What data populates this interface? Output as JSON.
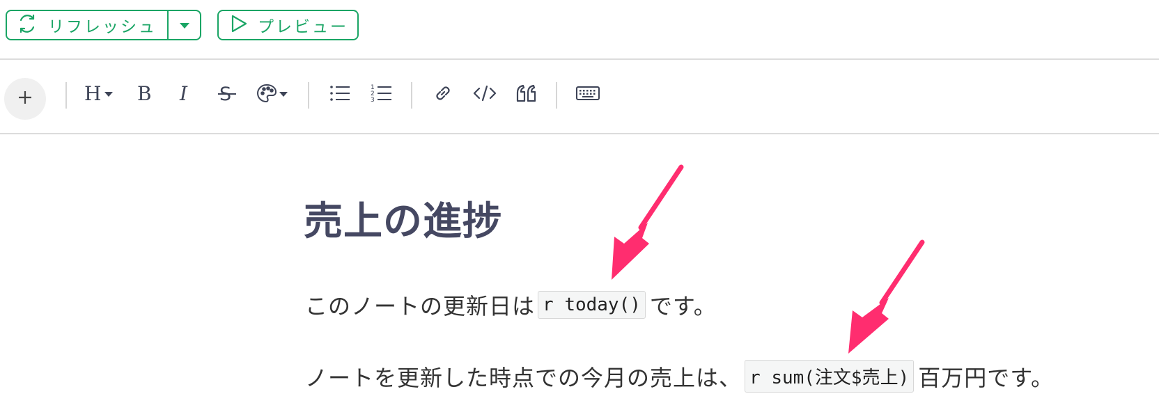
{
  "topbar": {
    "refresh_label": "リフレッシュ",
    "preview_label": "プレビュー",
    "accent_color": "#1aa565"
  },
  "toolbar": {
    "items": [
      "plus-icon",
      "heading-icon",
      "bold-icon",
      "italic-icon",
      "strikethrough-icon",
      "palette-icon",
      "bullet-list-icon",
      "numbered-list-icon",
      "link-icon",
      "code-icon",
      "quote-icon",
      "keyboard-icon"
    ]
  },
  "document": {
    "heading": "売上の進捗",
    "para1": {
      "before": "このノートの更新日は",
      "code": "r today()",
      "after": "です。"
    },
    "para2": {
      "before": "ノートを更新した時点での今月の売上は、",
      "code": "r sum(注文$売上)",
      "after": "百万円です。"
    }
  },
  "annotations": {
    "arrow_color": "#ff2d6f"
  }
}
